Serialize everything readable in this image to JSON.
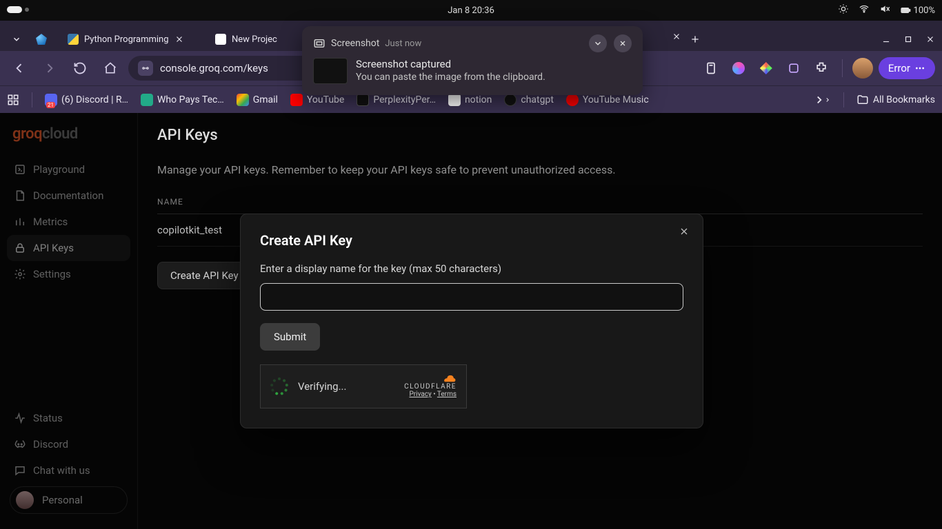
{
  "os": {
    "datetime": "Jan 8  20:36",
    "battery": "100%"
  },
  "browser": {
    "tabs": [
      {
        "label": "Python Programming"
      },
      {
        "label": "New Projec"
      }
    ],
    "url": "console.groq.com/keys",
    "error_label": "Error",
    "bookmarks": [
      {
        "label": "(6) Discord | R…"
      },
      {
        "label": "Who Pays Tec…"
      },
      {
        "label": "Gmail"
      },
      {
        "label": "YouTube"
      },
      {
        "label": "PerplexityPer…"
      },
      {
        "label": "notion"
      },
      {
        "label": "chatgpt"
      },
      {
        "label": "YouTube Music"
      }
    ],
    "all_bookmarks": "All Bookmarks"
  },
  "toast": {
    "app": "Screenshot",
    "when": "Just now",
    "title": "Screenshot captured",
    "body": "You can paste the image from the clipboard."
  },
  "sidebar": {
    "logo1": "groq",
    "logo2": "cloud",
    "items": [
      {
        "label": "Playground"
      },
      {
        "label": "Documentation"
      },
      {
        "label": "Metrics"
      },
      {
        "label": "API Keys"
      },
      {
        "label": "Settings"
      }
    ],
    "footer": [
      {
        "label": "Status"
      },
      {
        "label": "Discord"
      },
      {
        "label": "Chat with us"
      }
    ],
    "account": "Personal"
  },
  "page": {
    "title": "API Keys",
    "subtitle": "Manage your API keys. Remember to keep your API keys safe to prevent unauthorized access.",
    "col_name": "NAME",
    "rows": [
      {
        "name": "copilotkit_test"
      }
    ],
    "create_btn": "Create API Key"
  },
  "modal": {
    "title": "Create API Key",
    "label": "Enter a display name for the key (max 50 characters)",
    "value": "",
    "submit": "Submit",
    "cf_status": "Verifying...",
    "cf_brand": "CLOUDFLARE",
    "cf_privacy": "Privacy",
    "cf_terms": "Terms"
  }
}
